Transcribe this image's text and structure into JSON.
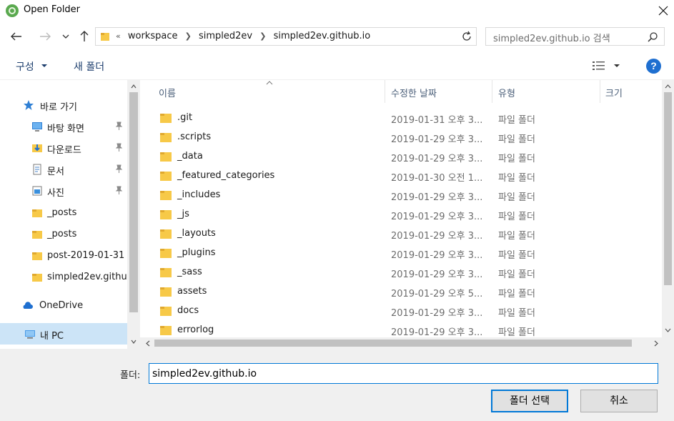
{
  "window": {
    "title": "Open Folder"
  },
  "address": {
    "overflow": "«",
    "crumbs": [
      "workspace",
      "simpled2ev",
      "simpled2ev.github.io"
    ]
  },
  "search": {
    "placeholder": "simpled2ev.github.io 검색"
  },
  "toolbar": {
    "organize": "구성",
    "new_folder": "새 폴더",
    "help": "?"
  },
  "nav": {
    "quick_access": "바로 가기",
    "pinned": [
      {
        "label": "바탕 화면",
        "icon": "desktop-icon"
      },
      {
        "label": "다운로드",
        "icon": "downloads-icon"
      },
      {
        "label": "문서",
        "icon": "documents-icon"
      },
      {
        "label": "사진",
        "icon": "pictures-icon"
      }
    ],
    "folders": [
      "_posts",
      "_posts",
      "post-2019-01-31",
      "simpled2ev.github"
    ],
    "onedrive": "OneDrive",
    "this_pc": "내 PC"
  },
  "columns": {
    "name": "이름",
    "date": "수정한 날짜",
    "type": "유형",
    "size": "크기"
  },
  "files": [
    {
      "name": ".git",
      "date": "2019-01-31 오후 3...",
      "type": "파일 폴더"
    },
    {
      "name": ".scripts",
      "date": "2019-01-29 오후 3...",
      "type": "파일 폴더"
    },
    {
      "name": "_data",
      "date": "2019-01-29 오후 3...",
      "type": "파일 폴더"
    },
    {
      "name": "_featured_categories",
      "date": "2019-01-30 오전 1...",
      "type": "파일 폴더"
    },
    {
      "name": "_includes",
      "date": "2019-01-29 오후 3...",
      "type": "파일 폴더"
    },
    {
      "name": "_js",
      "date": "2019-01-29 오후 3...",
      "type": "파일 폴더"
    },
    {
      "name": "_layouts",
      "date": "2019-01-29 오후 3...",
      "type": "파일 폴더"
    },
    {
      "name": "_plugins",
      "date": "2019-01-29 오후 3...",
      "type": "파일 폴더"
    },
    {
      "name": "_sass",
      "date": "2019-01-29 오후 3...",
      "type": "파일 폴더"
    },
    {
      "name": "assets",
      "date": "2019-01-29 오후 5...",
      "type": "파일 폴더"
    },
    {
      "name": "docs",
      "date": "2019-01-29 오후 3...",
      "type": "파일 폴더"
    },
    {
      "name": "errorlog",
      "date": "2019-01-29 오후 3...",
      "type": "파일 폴더"
    }
  ],
  "footer": {
    "folder_label": "폴더:",
    "folder_value": "simpled2ev.github.io",
    "select_button": "폴더 선택",
    "cancel_button": "취소"
  },
  "colors": {
    "accent": "#0078d7",
    "selected_bg": "#cce4f7",
    "folder_yellow": "#f7c948",
    "link_blue": "#1e3f6e"
  }
}
